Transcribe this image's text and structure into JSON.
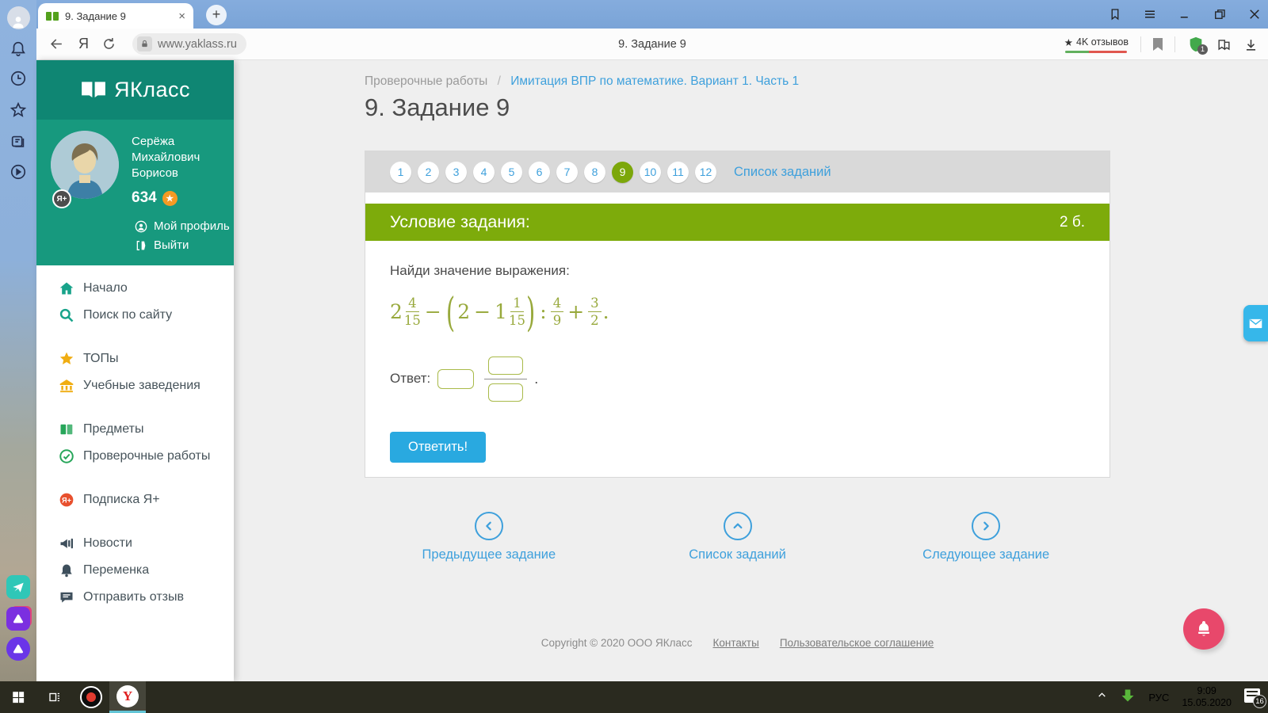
{
  "window": {
    "tab": {
      "title": "9. Задание 9"
    },
    "toolbar": {
      "url": "www.yaklass.ru",
      "page_title": "9. Задание 9",
      "reviews_label": "4K отзывов",
      "protect_badge": "1"
    }
  },
  "yaklass": {
    "logo_text": "ЯКласс",
    "profile": {
      "name_lines": [
        "Серёжа",
        "Михайлович",
        "Борисов"
      ],
      "points": "634",
      "plus_badge": "Я+",
      "profile_link": "Мой профиль",
      "logout_link": "Выйти"
    },
    "menu_groups": [
      {
        "items": [
          {
            "id": "home",
            "label": "Начало",
            "icon": "home-icon",
            "color": "#18a38a"
          },
          {
            "id": "site-search",
            "label": "Поиск по сайту",
            "icon": "search-icon",
            "color": "#18a38a"
          }
        ]
      },
      {
        "items": [
          {
            "id": "tops",
            "label": "ТОПы",
            "icon": "star-icon",
            "color": "#f0ad12"
          },
          {
            "id": "schools",
            "label": "Учебные заведения",
            "icon": "bank-icon",
            "color": "#f0ad12"
          }
        ]
      },
      {
        "items": [
          {
            "id": "subjects",
            "label": "Предметы",
            "icon": "books-icon",
            "color": "#27a65a"
          },
          {
            "id": "tests",
            "label": "Проверочные работы",
            "icon": "check-circle-icon",
            "color": "#27a65a"
          }
        ]
      },
      {
        "items": [
          {
            "id": "subscription",
            "label": "Подписка Я+",
            "icon": "ya-plus-icon",
            "color": "#e8502e"
          }
        ]
      },
      {
        "items": [
          {
            "id": "news",
            "label": "Новости",
            "icon": "megaphone-icon",
            "color": "#3e4f5c"
          },
          {
            "id": "peremenka",
            "label": "Переменка",
            "icon": "bell-icon",
            "color": "#3e4f5c"
          },
          {
            "id": "feedback",
            "label": "Отправить отзыв",
            "icon": "feedback-icon",
            "color": "#3e4f5c"
          }
        ]
      }
    ]
  },
  "main": {
    "breadcrumb": {
      "root": "Проверочные работы",
      "separator": "/",
      "current": "Имитация ВПР по математике. Вариант 1. Часть 1"
    },
    "title": "9. Задание 9",
    "task_nav": {
      "numbers": [
        "1",
        "2",
        "3",
        "4",
        "5",
        "6",
        "7",
        "8",
        "9",
        "10",
        "11",
        "12"
      ],
      "active": "9",
      "list_label": "Список заданий"
    },
    "condition": {
      "header": "Условие задания:",
      "points": "2 б.",
      "prompt": "Найди значение выражения:",
      "formula_tokens": [
        {
          "t": "mixed",
          "w": "2",
          "n": "4",
          "d": "15"
        },
        {
          "t": "op",
          "v": "−"
        },
        {
          "t": "lparen"
        },
        {
          "t": "num",
          "v": "2"
        },
        {
          "t": "op",
          "v": "−"
        },
        {
          "t": "mixed",
          "w": "1",
          "n": "1",
          "d": "15"
        },
        {
          "t": "rparen"
        },
        {
          "t": "op",
          "v": ":"
        },
        {
          "t": "frac",
          "n": "4",
          "d": "9"
        },
        {
          "t": "op",
          "v": "+"
        },
        {
          "t": "frac",
          "n": "3",
          "d": "2"
        },
        {
          "t": "text",
          "v": "."
        }
      ]
    },
    "answer": {
      "label": "Ответ:",
      "tail": "."
    },
    "submit_label": "Ответить!",
    "bottom_nav": [
      {
        "label": "Предыдущее задание",
        "icon": "chevron-left-circle-icon"
      },
      {
        "label": "Список заданий",
        "icon": "chevron-up-circle-icon"
      },
      {
        "label": "Следующее задание",
        "icon": "chevron-right-circle-icon"
      }
    ],
    "footer": {
      "copyright": "Copyright © 2020 ООО ЯКласс",
      "links": [
        "Контакты",
        "Пользовательское соглашение"
      ]
    }
  },
  "taskbar": {
    "lang": "РУС",
    "time": "9:09",
    "date": "15.05.2020",
    "notification_count": "16"
  },
  "colors": {
    "accent_blue": "#3ea0dc",
    "active_green": "#7dab0b",
    "panel_teal_dark": "#0f8673",
    "panel_teal": "#17997e",
    "formula_olive": "#98a93c",
    "fab_pink": "#e8486b",
    "submit_blue": "#29a9e0"
  }
}
